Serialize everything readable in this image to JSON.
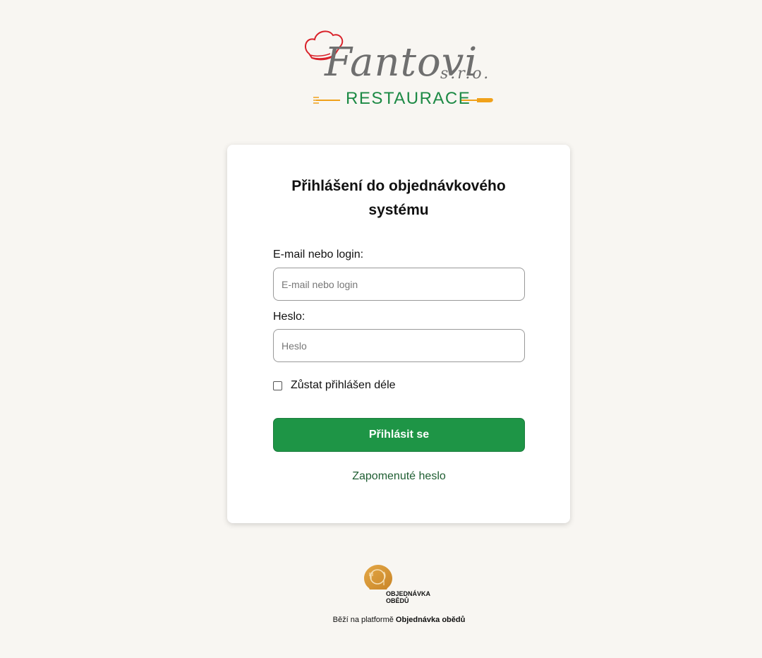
{
  "brand": {
    "name": "Fantovi",
    "suffix": "s.r.o.",
    "subtitle": "RESTAURACE",
    "colors": {
      "hat": "#d9222a",
      "script": "#6f6f6f",
      "subtitle": "#1d8a45",
      "cutlery": "#f0a11a"
    }
  },
  "login": {
    "title": "Přihlášení do objednávkového systému",
    "email_label": "E-mail nebo login:",
    "email_placeholder": "E-mail nebo login",
    "email_value": "",
    "password_label": "Heslo:",
    "password_placeholder": "Heslo",
    "password_value": "",
    "remember_label": "Zůstat přihlášen déle",
    "remember_checked": false,
    "submit_label": "Přihlásit se",
    "forgot_label": "Zapomenuté heslo"
  },
  "footer": {
    "platform_logo_line1": "OBJEDNÁVKA",
    "platform_logo_line2": "OBĚDŮ",
    "runs_on_prefix": "Běží na platformě ",
    "platform_name": "Objednávka obědů"
  },
  "colors": {
    "background": "#f8f6f2",
    "primary_button": "#1e9546",
    "link": "#1f5e32",
    "platform_logo": "#d89a3a"
  }
}
